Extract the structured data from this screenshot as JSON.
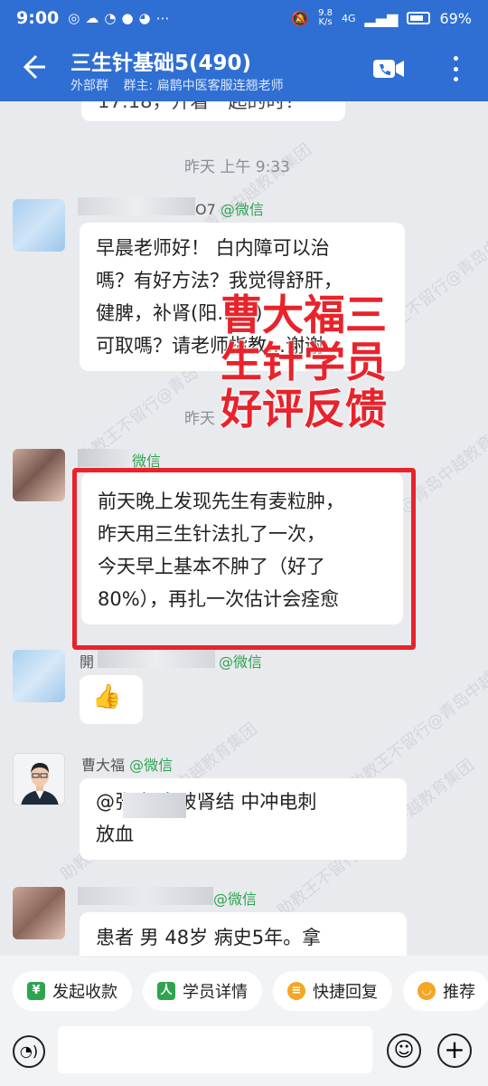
{
  "status_bar": {
    "time": "9:00",
    "net_speed_value": "9.8",
    "net_speed_unit": "K/s",
    "signal": "4G",
    "battery": "69%"
  },
  "header": {
    "title": "三生针基础5(490)",
    "group_type": "外部群",
    "owner": "群主: 扁鹊中医客服连翘老师"
  },
  "chat": {
    "partial_top_text": "17:18，开着一起的时？",
    "timestamp_1": "昨天  上午 9:33",
    "msg1": {
      "sender_suffix": "O7",
      "sender_tag": "@微信",
      "lines": [
        "早晨老师好！ 白内障可以治",
        "嗎？有好方法？我觉得舒肝，",
        "健脾，补肾(阳……)",
        "可取嗎？请老师指教…谢谢"
      ]
    },
    "timestamp_2": "昨天",
    "msg2": {
      "sender_tag": "微信",
      "lines": [
        "前天晚上发现先生有麦粒肿，",
        "昨天用三生针法扎了一次，",
        "今天早上基本不肿了（好了",
        "80%），再扎一次估计会痊愈"
      ]
    },
    "msg3": {
      "sender_prefix": "開",
      "sender_tag": "@微信",
      "emoji": "👍"
    },
    "msg4": {
      "sender": "曹大福",
      "sender_tag": "@微信",
      "lines": [
        "@张    加上破肾结 中冲电刺",
        "放血"
      ]
    },
    "msg5": {
      "sender_tag": "@微信",
      "lines": [
        "患者  男   48岁   病史5年。拿"
      ]
    },
    "overlay_lines": [
      "曹大福三",
      "生针学员",
      "好评反馈"
    ],
    "watermark": "助教王不留行@青岛中越教育集团"
  },
  "quick_actions": [
    {
      "label": "发起收款",
      "icon": "¥",
      "color": "#2ea44f"
    },
    {
      "label": "学员详情",
      "icon": "人",
      "color": "#2ea44f"
    },
    {
      "label": "快捷回复",
      "icon": "≡",
      "color": "#f5a623"
    },
    {
      "label": "推荐",
      "icon": "◡",
      "color": "#f5a623"
    }
  ],
  "input": {
    "placeholder": ""
  }
}
